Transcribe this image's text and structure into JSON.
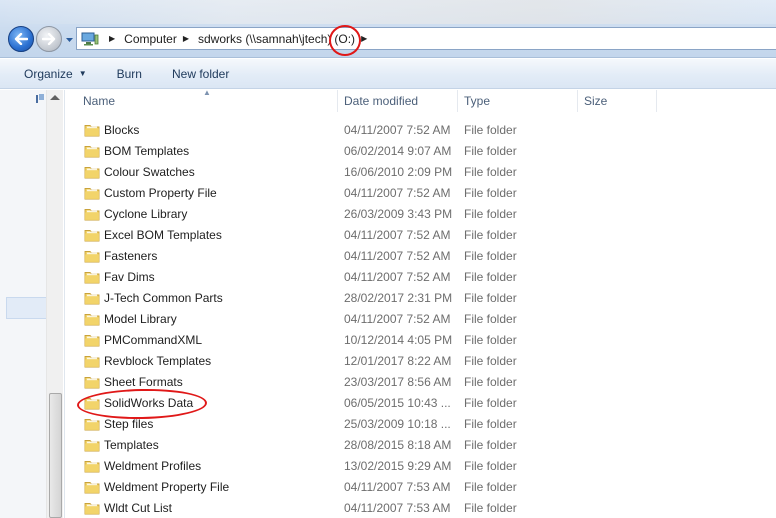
{
  "address_bar": {
    "computer_icon": "computer-icon",
    "breadcrumbs": [
      "Computer",
      "sdworks (\\\\samnah\\jtech)",
      "(O:)"
    ]
  },
  "toolbar": {
    "organize_label": "Organize",
    "burn_label": "Burn",
    "new_folder_label": "New folder"
  },
  "columns": {
    "name": "Name",
    "date": "Date modified",
    "type": "Type",
    "size": "Size"
  },
  "files": [
    {
      "name": "Blocks",
      "date": "04/11/2007 7:52 AM",
      "type": "File folder"
    },
    {
      "name": "BOM Templates",
      "date": "06/02/2014 9:07 AM",
      "type": "File folder"
    },
    {
      "name": "Colour Swatches",
      "date": "16/06/2010 2:09 PM",
      "type": "File folder"
    },
    {
      "name": "Custom Property File",
      "date": "04/11/2007 7:52 AM",
      "type": "File folder"
    },
    {
      "name": "Cyclone Library",
      "date": "26/03/2009 3:43 PM",
      "type": "File folder"
    },
    {
      "name": "Excel BOM Templates",
      "date": "04/11/2007 7:52 AM",
      "type": "File folder"
    },
    {
      "name": "Fasteners",
      "date": "04/11/2007 7:52 AM",
      "type": "File folder"
    },
    {
      "name": "Fav Dims",
      "date": "04/11/2007 7:52 AM",
      "type": "File folder"
    },
    {
      "name": "J-Tech Common Parts",
      "date": "28/02/2017 2:31 PM",
      "type": "File folder"
    },
    {
      "name": "Model Library",
      "date": "04/11/2007 7:52 AM",
      "type": "File folder"
    },
    {
      "name": "PMCommandXML",
      "date": "10/12/2014 4:05 PM",
      "type": "File folder"
    },
    {
      "name": "Revblock Templates",
      "date": "12/01/2017 8:22 AM",
      "type": "File folder"
    },
    {
      "name": "Sheet Formats",
      "date": "23/03/2017 8:56 AM",
      "type": "File folder"
    },
    {
      "name": "SolidWorks Data",
      "date": "06/05/2015 10:43 ...",
      "type": "File folder"
    },
    {
      "name": "Step files",
      "date": "25/03/2009 10:18 ...",
      "type": "File folder"
    },
    {
      "name": "Templates",
      "date": "28/08/2015 8:18 AM",
      "type": "File folder"
    },
    {
      "name": "Weldment Profiles",
      "date": "13/02/2015 9:29 AM",
      "type": "File folder"
    },
    {
      "name": "Weldment Property File",
      "date": "04/11/2007 7:53 AM",
      "type": "File folder"
    },
    {
      "name": "Wldt Cut List",
      "date": "04/11/2007 7:53 AM",
      "type": "File folder"
    }
  ],
  "colors": {
    "annotation": "#e01818",
    "folder_fill": "#f2d46a",
    "folder_edge": "#c9a23a"
  }
}
